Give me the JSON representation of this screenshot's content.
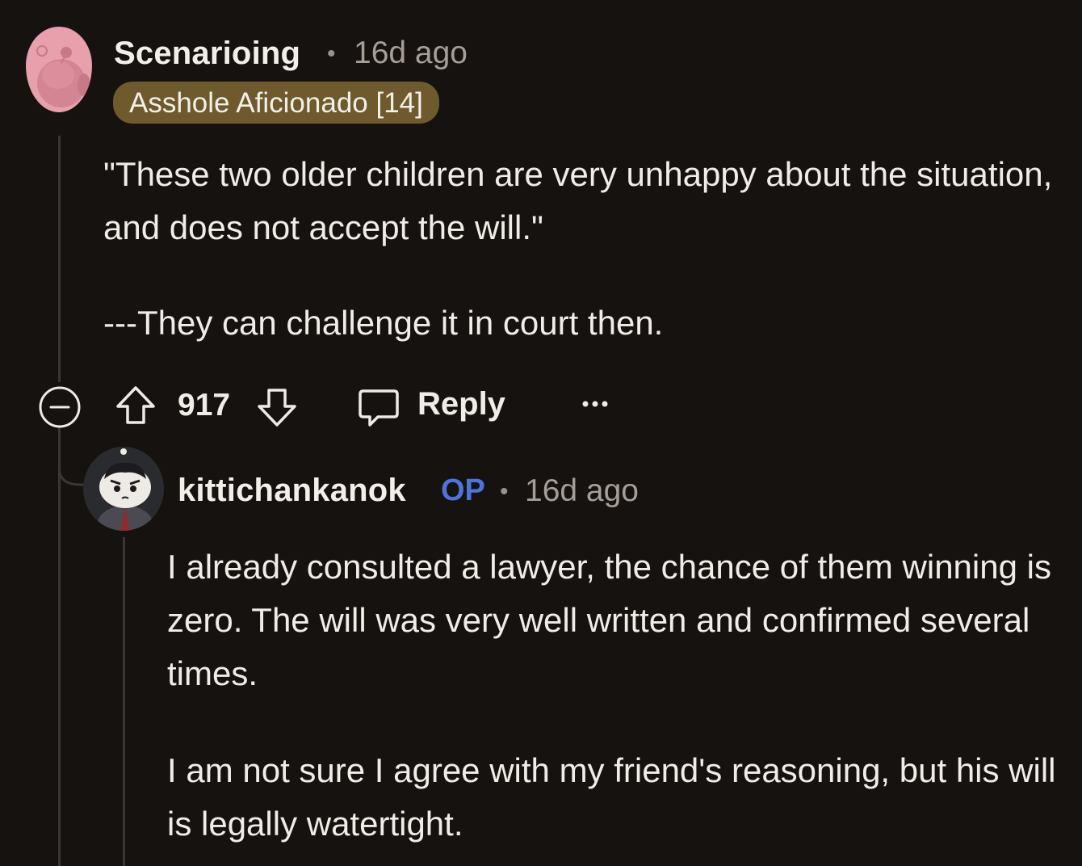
{
  "comments": [
    {
      "username": "Scenarioing",
      "separator": "•",
      "time": "16d ago",
      "flair": "Asshole Aficionado [14]",
      "paragraphs": [
        "\"These two older children are very unhappy about the situation, and does not accept the will.\"",
        "---They can challenge it in court then."
      ],
      "votes": "917",
      "reply_label": "Reply",
      "avatar_colors": {
        "bg": "#e8a0ad",
        "fg": "#d38593"
      }
    },
    {
      "username": "kittichankanok",
      "op_badge": "OP",
      "separator": "•",
      "time": "16d ago",
      "paragraphs": [
        "I already consulted a lawyer, the chance of them winning is zero. The will was very well written and confirmed several times.",
        "I am not sure I agree with my friend's reasoning, but his will is legally watertight."
      ]
    }
  ],
  "colors": {
    "background": "#16120f",
    "thread_line": "#3b3632",
    "flair_bg": "#6e5a2c",
    "op": "#4d74d9"
  }
}
